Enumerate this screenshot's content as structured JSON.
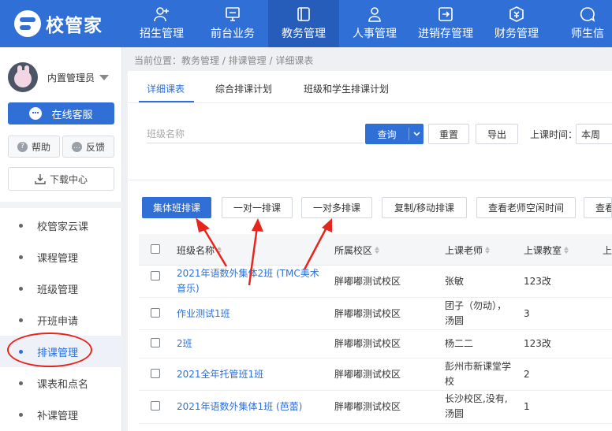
{
  "brand": {
    "name": "校管家"
  },
  "nav": {
    "items": [
      {
        "label": "招生管理",
        "icon": "user-plus-icon"
      },
      {
        "label": "前台业务",
        "icon": "monitor-icon"
      },
      {
        "label": "教务管理",
        "icon": "book-icon",
        "active": true
      },
      {
        "label": "人事管理",
        "icon": "person-icon"
      },
      {
        "label": "进销存管理",
        "icon": "inventory-icon"
      },
      {
        "label": "财务管理",
        "icon": "finance-icon"
      },
      {
        "label": "师生信",
        "icon": "message-icon"
      }
    ]
  },
  "sidebar": {
    "user_name": "内置管理员",
    "online_service": "在线客服",
    "help": "帮助",
    "feedback": "反馈",
    "download_center": "下载中心",
    "menu": [
      {
        "label": "校管家云课"
      },
      {
        "label": "课程管理"
      },
      {
        "label": "班级管理"
      },
      {
        "label": "开班申请"
      },
      {
        "label": "排课管理",
        "active": true
      },
      {
        "label": "课表和点名"
      },
      {
        "label": "补课管理"
      }
    ]
  },
  "breadcrumb": "当前位置：教务管理 / 排课管理 / 详细课表",
  "tabs": [
    {
      "label": "详细课表",
      "active": true
    },
    {
      "label": "综合排课计划"
    },
    {
      "label": "班级和学生排课计划"
    }
  ],
  "filters": {
    "class_name_placeholder": "班级名称",
    "query": "查询",
    "reset": "重置",
    "export": "导出",
    "time_label": "上课时间：",
    "time_value": "本周"
  },
  "actions": [
    {
      "label": "集体班排课"
    },
    {
      "label": "一对一排课"
    },
    {
      "label": "一对多排课"
    },
    {
      "label": "复制/移动排课"
    },
    {
      "label": "查看老师空闲时间"
    },
    {
      "label": "查看"
    }
  ],
  "table": {
    "columns": [
      "班级名称",
      "所属校区",
      "上课老师",
      "上课教室",
      "上"
    ],
    "rows": [
      {
        "class_name": "2021年语数外集体2班 (TMC美术音乐)",
        "campus": "胖嘟嘟测试校区",
        "teacher": "张敏",
        "room": "123改"
      },
      {
        "class_name": "作业测试1班",
        "campus": "胖嘟嘟测试校区",
        "teacher": "团子（勿动），汤圆",
        "room": "3"
      },
      {
        "class_name": "2班",
        "campus": "胖嘟嘟测试校区",
        "teacher": "杨二二",
        "room": "123改"
      },
      {
        "class_name": "2021全年托管班1班",
        "campus": "胖嘟嘟测试校区",
        "teacher": "彭州市新课堂学校",
        "room": "2"
      },
      {
        "class_name": "2021年语数外集体1班 (芭蕾)",
        "campus": "胖嘟嘟测试校区",
        "teacher": "长沙校区,没有,汤圆",
        "room": "1"
      }
    ]
  },
  "colors": {
    "primary": "#2f6fd6",
    "annotation": "#e8251d"
  }
}
